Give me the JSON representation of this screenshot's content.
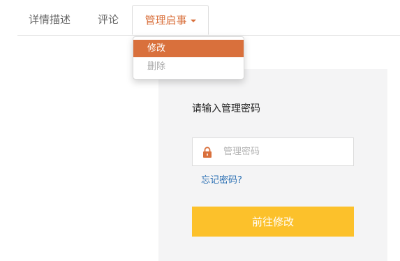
{
  "tabs": {
    "detail_label": "详情描述",
    "comment_label": "评论",
    "manage_label": "管理启事"
  },
  "dropdown": {
    "items": [
      {
        "label": "修改",
        "active": true
      },
      {
        "label": "删除",
        "active": false
      }
    ]
  },
  "panel": {
    "title": "请输入管理密码",
    "password_placeholder": "管理密码",
    "password_value": "",
    "forgot_link": "忘记密码?",
    "submit_label": "前往修改"
  },
  "icons": {
    "lock": "lock-icon",
    "caret": "caret-down-icon"
  },
  "colors": {
    "accent": "#d9703c",
    "button": "#fcc12b",
    "link": "#2a6fb3",
    "panel_bg": "#f4f4f5"
  }
}
